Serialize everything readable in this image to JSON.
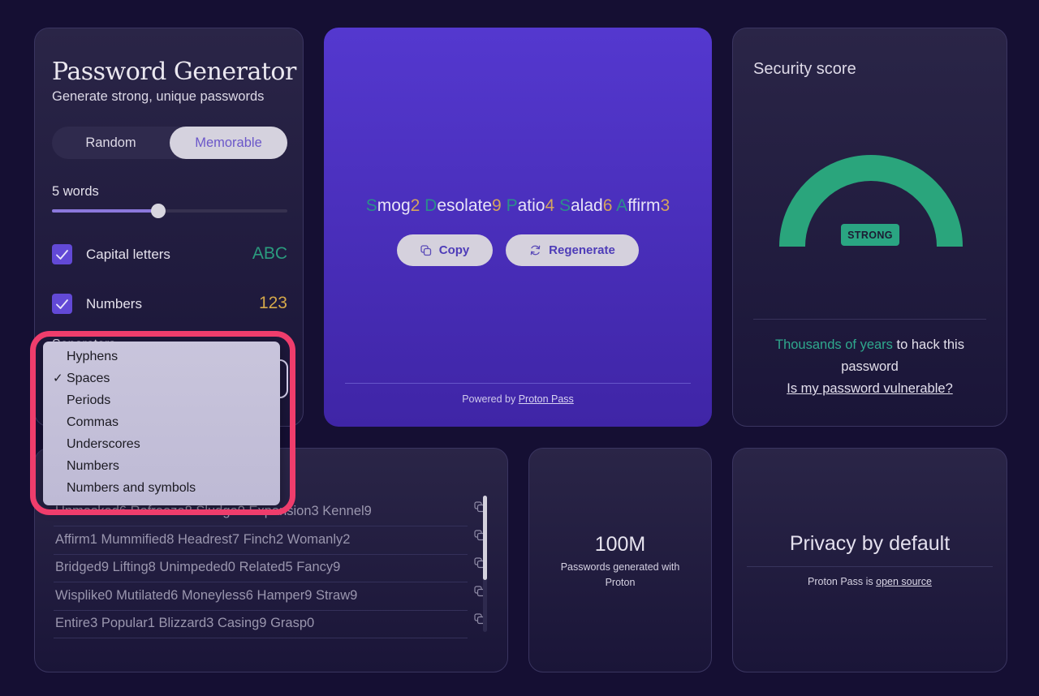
{
  "generator": {
    "title": "Password Generator",
    "subtitle": "Generate strong, unique passwords",
    "modes": [
      {
        "label": "Random",
        "selected": false
      },
      {
        "label": "Memorable",
        "selected": true
      }
    ],
    "word_count_label": "5 words",
    "word_count_slider": {
      "value": 5,
      "fill_fraction": 0.45
    },
    "options": [
      {
        "label": "Capital letters",
        "checked": true,
        "sample": "ABC",
        "sample_color": "#2b9b7e"
      },
      {
        "label": "Numbers",
        "checked": true,
        "sample": "123",
        "sample_color": "#d4a84a"
      }
    ],
    "separator": {
      "label": "Separators",
      "selected": "Spaces",
      "options": [
        "Hyphens",
        "Spaces",
        "Periods",
        "Commas",
        "Underscores",
        "Numbers",
        "Numbers and symbols"
      ]
    }
  },
  "password": {
    "words": [
      {
        "cap": "S",
        "rest": "mog",
        "num": "2"
      },
      {
        "cap": "D",
        "rest": "esolate",
        "num": "9"
      },
      {
        "cap": "P",
        "rest": "atio",
        "num": "4"
      },
      {
        "cap": "S",
        "rest": "alad",
        "num": "6"
      },
      {
        "cap": "A",
        "rest": "ffirm",
        "num": "3"
      }
    ],
    "copy_label": "Copy",
    "regenerate_label": "Regenerate",
    "powered_by": "Powered by",
    "powered_link": "Proton Pass"
  },
  "security": {
    "title": "Security score",
    "strength_badge": "STRONG",
    "strength_color": "#2aa57c",
    "gauge_fraction": 1.0,
    "time_highlight": "Thousands of years",
    "time_rest": "to hack this password",
    "vulnerable_link": "Is my password vulnerable?"
  },
  "history": {
    "items": [
      "Unmasked6 Refreeze8 Sludge9 Expansion3 Kennel9",
      "Affirm1 Mummified8 Headrest7 Finch2 Womanly2",
      "Bridged9 Lifting8 Unimpeded0 Related5 Fancy9",
      "Wisplike0 Mutilated6 Moneyless6 Hamper9 Straw9",
      "Entire3 Popular1 Blizzard3 Casing9 Grasp0"
    ]
  },
  "stats": {
    "value": "100M",
    "caption": "Passwords generated with Proton"
  },
  "privacy": {
    "title": "Privacy by default",
    "text": "Proton Pass is",
    "link": "open source"
  },
  "icons": {
    "checkbox": "check-icon",
    "copy": "copy-icon",
    "regenerate": "refresh-icon"
  }
}
